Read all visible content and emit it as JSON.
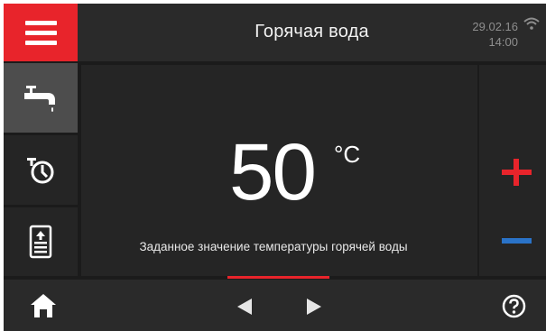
{
  "header": {
    "title": "Горячая вода",
    "date": "29.02.16",
    "time": "14:00"
  },
  "sidebar": {
    "items": [
      {
        "icon": "faucet-icon",
        "active": true
      },
      {
        "icon": "timer-icon",
        "active": false
      },
      {
        "icon": "water-tank-icon",
        "active": false
      }
    ]
  },
  "main": {
    "temperature": "50",
    "unit": "°C",
    "label": "Заданное значение температуры горячей воды"
  },
  "controls": {
    "increase": "plus-icon",
    "decrease": "minus-icon"
  },
  "footer": {
    "home": "home-icon",
    "prev": "left-arrow-icon",
    "next": "right-arrow-icon",
    "help": "help-icon"
  },
  "colors": {
    "accent": "#e8242b",
    "minus": "#2a73c8",
    "background": "#1b1b1b",
    "panel": "#252525"
  }
}
